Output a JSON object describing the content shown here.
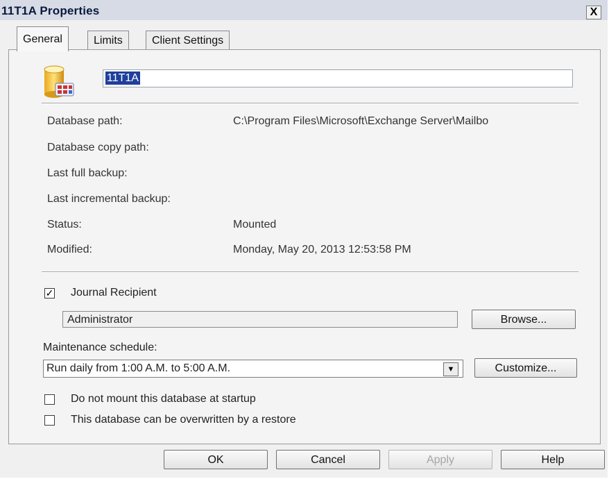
{
  "window": {
    "title": "11T1A Properties",
    "close_glyph": "X"
  },
  "tabs": [
    {
      "label": "General",
      "active": true
    },
    {
      "label": "Limits",
      "active": false
    },
    {
      "label": "Client Settings",
      "active": false
    }
  ],
  "general": {
    "icon": "database-icon",
    "name_value": "11T1A",
    "fields": {
      "database_path_label": "Database path:",
      "database_path_value": "C:\\Program Files\\Microsoft\\Exchange Server\\Mailbo",
      "database_copy_path_label": "Database copy path:",
      "last_full_backup_label": "Last full backup:",
      "last_incremental_backup_label": "Last incremental backup:",
      "status_label": "Status:",
      "status_value": "Mounted",
      "modified_label": "Modified:",
      "modified_value": "Monday, May 20, 2013 12:53:58 PM"
    },
    "journal": {
      "label": "Journal Recipient",
      "checked": true,
      "check_glyph": "✓",
      "recipient_value": "Administrator",
      "browse_label": "Browse..."
    },
    "maintenance": {
      "label": "Maintenance schedule:",
      "selected": "Run daily from 1:00 A.M. to 5:00 A.M.",
      "customize_label": "Customize..."
    },
    "options": {
      "no_mount_label": "Do not mount this database at startup",
      "no_mount_checked": false,
      "overwrite_label": "This database can be overwritten by a restore",
      "overwrite_checked": false
    }
  },
  "footer": {
    "ok_label": "OK",
    "cancel_label": "Cancel",
    "apply_label": "Apply",
    "help_label": "Help"
  }
}
